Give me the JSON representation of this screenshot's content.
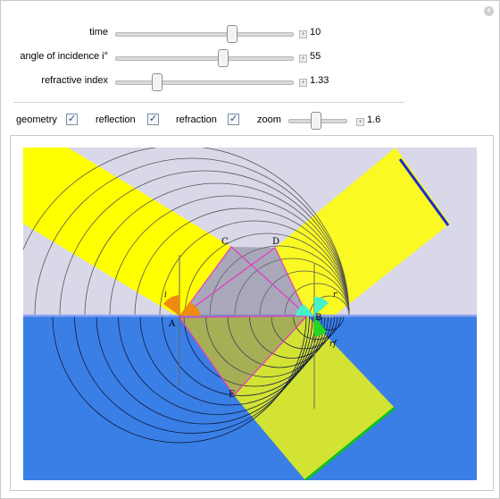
{
  "controls": {
    "time": {
      "label": "time",
      "value": "10",
      "fraction": 0.65
    },
    "angle": {
      "label": "angle of incidence i°",
      "value": "55",
      "fraction": 0.6
    },
    "index": {
      "label": "refractive index",
      "value": "1.33",
      "fraction": 0.23
    }
  },
  "options": {
    "geometry": {
      "label": "geometry",
      "checked": true
    },
    "reflection": {
      "label": "reflection",
      "checked": true
    },
    "refraction": {
      "label": "refraction",
      "checked": true
    },
    "zoom": {
      "label": "zoom",
      "value": "1.6",
      "fraction": 0.45
    }
  },
  "plot": {
    "points": {
      "A": "A",
      "B": "B",
      "C": "C",
      "D": "D",
      "E": "E"
    },
    "angle_labels": {
      "incidence": "i",
      "reflection": "r",
      "refraction": "rf"
    },
    "colors": {
      "air": "#d9d8e9",
      "water": "#3a7fe6",
      "beam": "#ffff00",
      "interface": "#8da1f2",
      "geometry": "#e040c0",
      "incidence_wedge": "#f08a10",
      "reflection_wedge": "#48f0c8",
      "refraction_wedge": "#20d820",
      "reflected_front": "#1a2bd0",
      "refracted_front": "#10c020"
    }
  }
}
